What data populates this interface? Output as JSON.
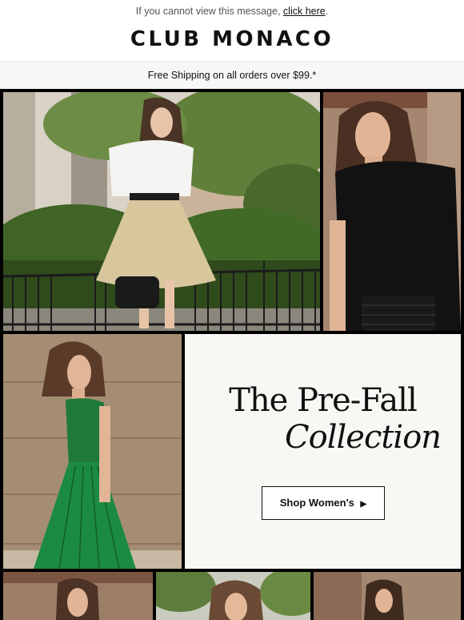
{
  "preheader": {
    "text": "If you cannot view this message,",
    "link": "click here",
    "suffix": "."
  },
  "brand": {
    "logo_text": "CLUB MONACO"
  },
  "shipping_bar": {
    "text": "Free Shipping on all orders over $99.*"
  },
  "hero": {
    "title_line1": "The Pre-Fall",
    "title_line2": "Collection",
    "cta_label": "Shop Women's",
    "cta_arrow": "▶"
  },
  "colors": {
    "background": "#ffffff",
    "grid_border": "#000000",
    "promo_panel": "#f9f7f4",
    "text": "#111111",
    "green_dress": "#1f7a3a",
    "black_top": "#121212",
    "white_shirt": "#f4f4f2",
    "skirt": "#d8c79d"
  }
}
